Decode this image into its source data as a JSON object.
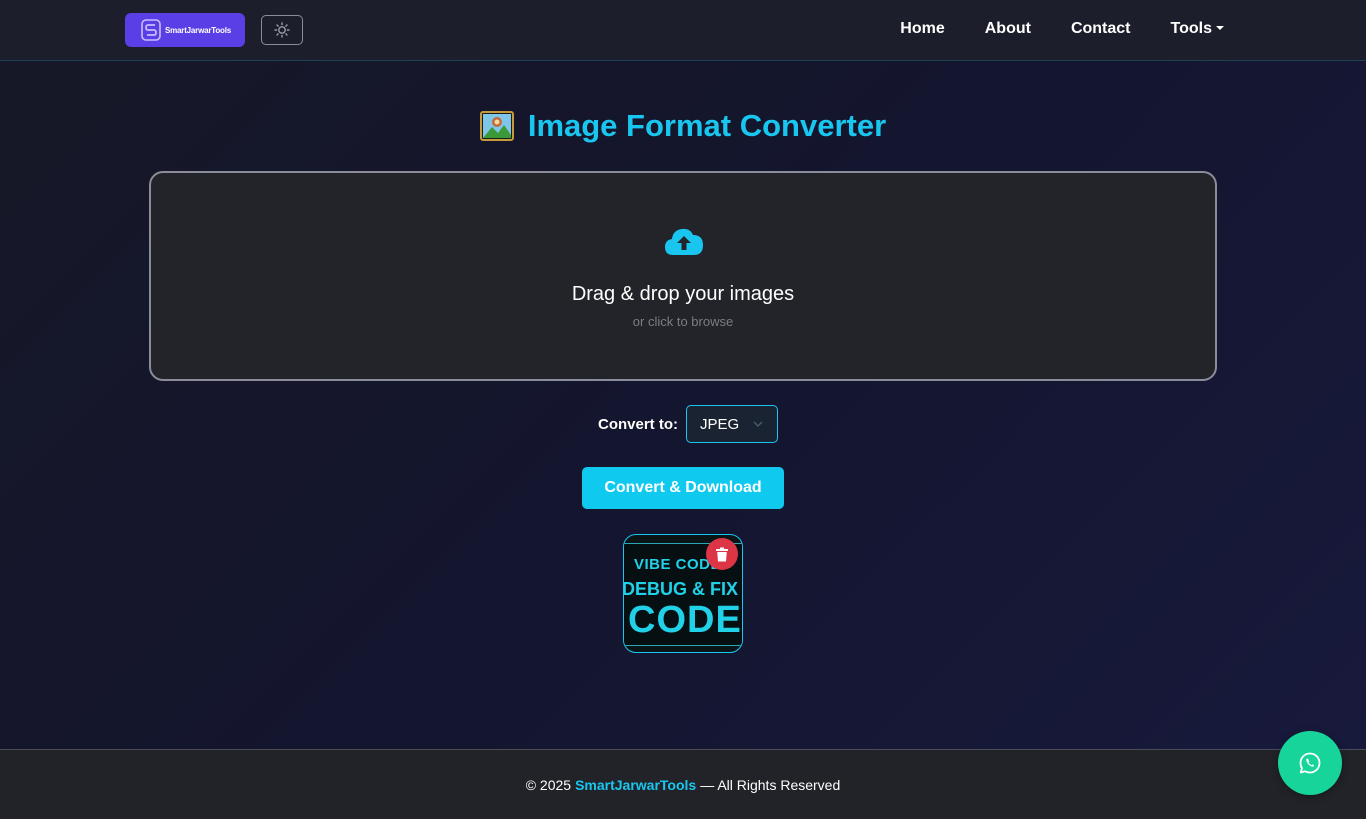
{
  "navbar": {
    "logo_text": "SmartJarwarTools",
    "theme_toggle_icon": "sun-icon",
    "links": {
      "home": "Home",
      "about": "About",
      "contact": "Contact",
      "tools": "Tools"
    }
  },
  "page": {
    "title": "Image Format Converter",
    "title_icon": "framed-picture-icon"
  },
  "dropzone": {
    "icon": "cloud-upload-icon",
    "title": "Drag & drop your images",
    "subtitle": "or click to browse"
  },
  "convert": {
    "label": "Convert to:",
    "selected_format": "JPEG",
    "button_label": "Convert & Download"
  },
  "thumbnail": {
    "line1": "VIBE CODE",
    "line2": "DEBUG & FIX",
    "line3": "CODE",
    "delete_icon": "trash-icon"
  },
  "footer": {
    "prefix": "© 2025",
    "brand": "SmartJarwarTools",
    "suffix": "— All Rights Reserved"
  },
  "floating": {
    "whatsapp_icon": "whatsapp-icon"
  },
  "colors": {
    "accent": "#19c6ef",
    "logo_bg": "#5b3fe6",
    "delete": "#dc3545",
    "whatsapp": "#17d49a"
  }
}
